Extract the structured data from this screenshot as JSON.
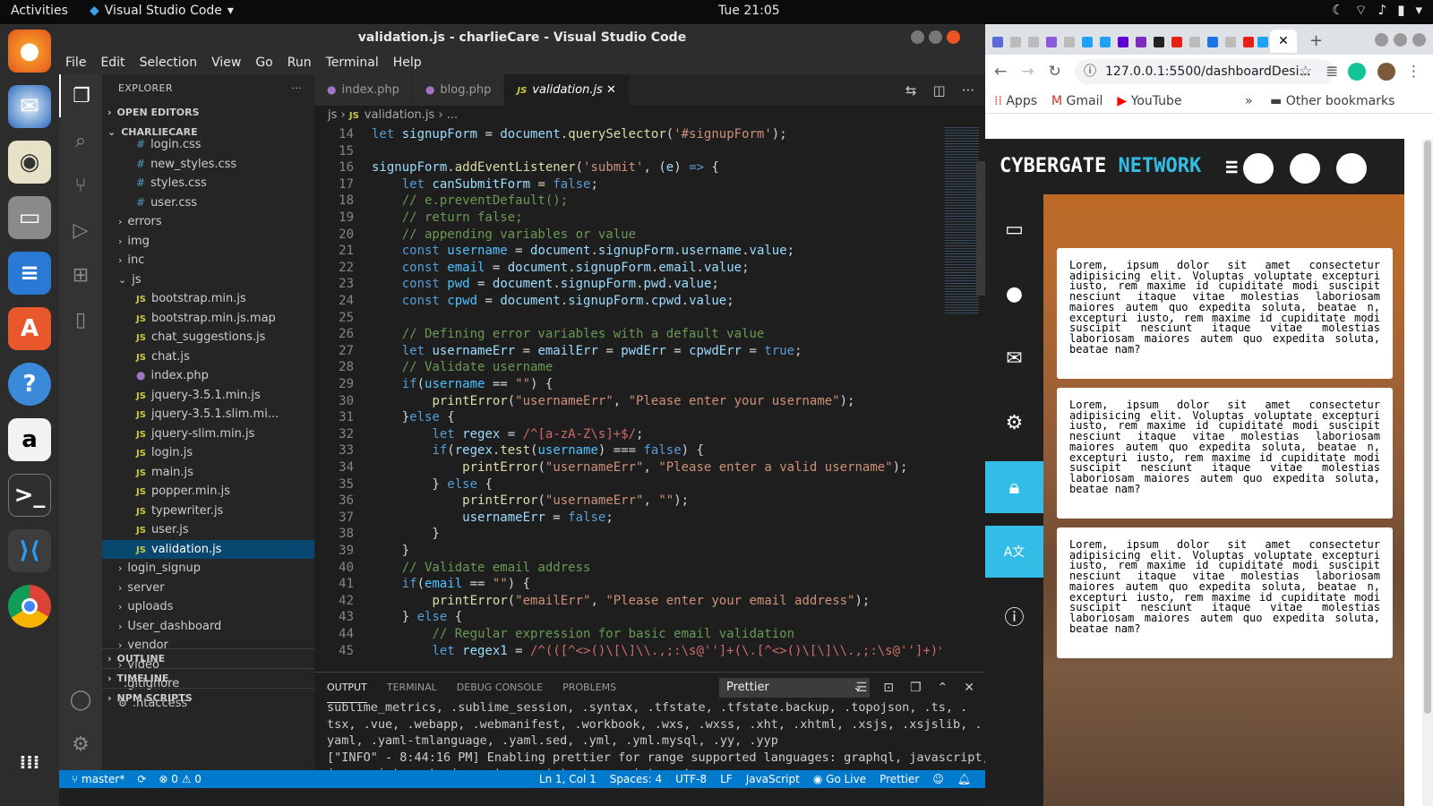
{
  "topbar": {
    "activities": "Activities",
    "app": "Visual Studio Code",
    "clock": "Tue 21:05"
  },
  "vscode": {
    "title": "validation.js - charlieCare - Visual Studio Code",
    "menu": [
      "File",
      "Edit",
      "Selection",
      "View",
      "Go",
      "Run",
      "Terminal",
      "Help"
    ],
    "explorer": {
      "header": "EXPLORER",
      "open_editors": "OPEN EDITORS",
      "project": "CHARLIECARE",
      "files": [
        {
          "name": "login.css",
          "type": "css",
          "indent": 1
        },
        {
          "name": "new_styles.css",
          "type": "css",
          "indent": 1
        },
        {
          "name": "styles.css",
          "type": "css",
          "indent": 1
        },
        {
          "name": "user.css",
          "type": "css",
          "indent": 1
        },
        {
          "name": "errors",
          "type": "folder",
          "indent": 0
        },
        {
          "name": "img",
          "type": "folder",
          "indent": 0
        },
        {
          "name": "inc",
          "type": "folder",
          "indent": 0
        },
        {
          "name": "js",
          "type": "open",
          "indent": 0
        },
        {
          "name": "bootstrap.min.js",
          "type": "js",
          "indent": 1
        },
        {
          "name": "bootstrap.min.js.map",
          "type": "js",
          "indent": 1
        },
        {
          "name": "chat_suggestions.js",
          "type": "js",
          "indent": 1
        },
        {
          "name": "chat.js",
          "type": "js",
          "indent": 1
        },
        {
          "name": "index.php",
          "type": "php",
          "indent": 1
        },
        {
          "name": "jquery-3.5.1.min.js",
          "type": "js",
          "indent": 1
        },
        {
          "name": "jquery-3.5.1.slim.mi...",
          "type": "js",
          "indent": 1
        },
        {
          "name": "jquery-slim.min.js",
          "type": "js",
          "indent": 1
        },
        {
          "name": "login.js",
          "type": "js",
          "indent": 1
        },
        {
          "name": "main.js",
          "type": "js",
          "indent": 1
        },
        {
          "name": "popper.min.js",
          "type": "js",
          "indent": 1
        },
        {
          "name": "typewriter.js",
          "type": "js",
          "indent": 1
        },
        {
          "name": "user.js",
          "type": "js",
          "indent": 1
        },
        {
          "name": "validation.js",
          "type": "js",
          "indent": 1,
          "selected": true
        },
        {
          "name": "login_signup",
          "type": "folder",
          "indent": 0
        },
        {
          "name": "server",
          "type": "folder",
          "indent": 0
        },
        {
          "name": "uploads",
          "type": "folder",
          "indent": 0
        },
        {
          "name": "User_dashboard",
          "type": "folder",
          "indent": 0
        },
        {
          "name": "vendor",
          "type": "folder",
          "indent": 0
        },
        {
          "name": "video",
          "type": "folder",
          "indent": 0
        },
        {
          "name": ".gitignore",
          "type": "plain",
          "indent": 0
        },
        {
          "name": ".htaccess",
          "type": "gear",
          "indent": 0
        }
      ],
      "outline": "OUTLINE",
      "timeline": "TIMELINE",
      "npm": "NPM SCRIPTS"
    },
    "tabs": [
      {
        "label": "index.php",
        "type": "php"
      },
      {
        "label": "blog.php",
        "type": "php"
      },
      {
        "label": "validation.js",
        "type": "js",
        "active": true
      }
    ],
    "breadcrumb": {
      "folder": "js",
      "file": "validation.js",
      "rest": "..."
    },
    "code": [
      {
        "n": "14",
        "t": [
          [
            "k",
            "let "
          ],
          [
            "v",
            "signupForm"
          ],
          [
            "p",
            " = "
          ],
          [
            "v",
            "document"
          ],
          [
            "p",
            "."
          ],
          [
            "f",
            "querySelector"
          ],
          [
            "p",
            "("
          ],
          [
            "s",
            "'#signupForm'"
          ],
          [
            "p",
            ");"
          ]
        ]
      },
      {
        "n": "15",
        "t": []
      },
      {
        "n": "16",
        "t": [
          [
            "v",
            "signupForm"
          ],
          [
            "p",
            "."
          ],
          [
            "f",
            "addEventListener"
          ],
          [
            "p",
            "("
          ],
          [
            "s",
            "'submit'"
          ],
          [
            "p",
            ", ("
          ],
          [
            "v",
            "e"
          ],
          [
            "p",
            ") "
          ],
          [
            "k",
            "=>"
          ],
          [
            "p",
            " {"
          ]
        ]
      },
      {
        "n": "17",
        "t": [
          [
            "p",
            "    "
          ],
          [
            "k",
            "let "
          ],
          [
            "v",
            "canSubmitForm"
          ],
          [
            "p",
            " = "
          ],
          [
            "k",
            "false"
          ],
          [
            "p",
            ";"
          ]
        ]
      },
      {
        "n": "18",
        "t": [
          [
            "p",
            "    "
          ],
          [
            "c",
            "// e.preventDefault();"
          ]
        ]
      },
      {
        "n": "19",
        "t": [
          [
            "p",
            "    "
          ],
          [
            "c",
            "// return false;"
          ]
        ]
      },
      {
        "n": "20",
        "t": [
          [
            "p",
            "    "
          ],
          [
            "c",
            "// appending variables or value"
          ]
        ]
      },
      {
        "n": "21",
        "t": [
          [
            "p",
            "    "
          ],
          [
            "k",
            "const "
          ],
          [
            "cn",
            "username"
          ],
          [
            "p",
            " = "
          ],
          [
            "v",
            "document"
          ],
          [
            "p",
            "."
          ],
          [
            "v",
            "signupForm"
          ],
          [
            "p",
            "."
          ],
          [
            "v",
            "username"
          ],
          [
            "p",
            "."
          ],
          [
            "v",
            "value"
          ],
          [
            "p",
            ";"
          ]
        ]
      },
      {
        "n": "22",
        "t": [
          [
            "p",
            "    "
          ],
          [
            "k",
            "const "
          ],
          [
            "cn",
            "email"
          ],
          [
            "p",
            " = "
          ],
          [
            "v",
            "document"
          ],
          [
            "p",
            "."
          ],
          [
            "v",
            "signupForm"
          ],
          [
            "p",
            "."
          ],
          [
            "v",
            "email"
          ],
          [
            "p",
            "."
          ],
          [
            "v",
            "value"
          ],
          [
            "p",
            ";"
          ]
        ]
      },
      {
        "n": "23",
        "t": [
          [
            "p",
            "    "
          ],
          [
            "k",
            "const "
          ],
          [
            "cn",
            "pwd"
          ],
          [
            "p",
            " = "
          ],
          [
            "v",
            "document"
          ],
          [
            "p",
            "."
          ],
          [
            "v",
            "signupForm"
          ],
          [
            "p",
            "."
          ],
          [
            "v",
            "pwd"
          ],
          [
            "p",
            "."
          ],
          [
            "v",
            "value"
          ],
          [
            "p",
            ";"
          ]
        ]
      },
      {
        "n": "24",
        "t": [
          [
            "p",
            "    "
          ],
          [
            "k",
            "const "
          ],
          [
            "cn",
            "cpwd"
          ],
          [
            "p",
            " = "
          ],
          [
            "v",
            "document"
          ],
          [
            "p",
            "."
          ],
          [
            "v",
            "signupForm"
          ],
          [
            "p",
            "."
          ],
          [
            "v",
            "cpwd"
          ],
          [
            "p",
            "."
          ],
          [
            "v",
            "value"
          ],
          [
            "p",
            ";"
          ]
        ]
      },
      {
        "n": "25",
        "t": []
      },
      {
        "n": "26",
        "t": [
          [
            "p",
            "    "
          ],
          [
            "c",
            "// Defining error variables with a default value"
          ]
        ]
      },
      {
        "n": "27",
        "t": [
          [
            "p",
            "    "
          ],
          [
            "k",
            "let "
          ],
          [
            "v",
            "usernameErr"
          ],
          [
            "p",
            " = "
          ],
          [
            "v",
            "emailErr"
          ],
          [
            "p",
            " = "
          ],
          [
            "v",
            "pwdErr"
          ],
          [
            "p",
            " = "
          ],
          [
            "v",
            "cpwdErr"
          ],
          [
            "p",
            " = "
          ],
          [
            "k",
            "true"
          ],
          [
            "p",
            ";"
          ]
        ]
      },
      {
        "n": "28",
        "t": [
          [
            "p",
            "    "
          ],
          [
            "c",
            "// Validate username"
          ]
        ]
      },
      {
        "n": "29",
        "t": [
          [
            "p",
            "    "
          ],
          [
            "k",
            "if"
          ],
          [
            "p",
            "("
          ],
          [
            "cn",
            "username"
          ],
          [
            "p",
            " == "
          ],
          [
            "s",
            "\"\""
          ],
          [
            "p",
            ") {"
          ]
        ]
      },
      {
        "n": "30",
        "t": [
          [
            "p",
            "        "
          ],
          [
            "f",
            "printError"
          ],
          [
            "p",
            "("
          ],
          [
            "s",
            "\"usernameErr\""
          ],
          [
            "p",
            ", "
          ],
          [
            "s",
            "\"Please enter your username\""
          ],
          [
            "p",
            ");"
          ]
        ]
      },
      {
        "n": "31",
        "t": [
          [
            "p",
            "    }"
          ],
          [
            "k",
            "else"
          ],
          [
            "p",
            " {"
          ]
        ]
      },
      {
        "n": "32",
        "t": [
          [
            "p",
            "        "
          ],
          [
            "k",
            "let "
          ],
          [
            "v",
            "regex"
          ],
          [
            "p",
            " = "
          ],
          [
            "r",
            "/^[a-zA-Z\\s]+$/"
          ],
          [
            "p",
            ";"
          ]
        ]
      },
      {
        "n": "33",
        "t": [
          [
            "p",
            "        "
          ],
          [
            "k",
            "if"
          ],
          [
            "p",
            "("
          ],
          [
            "v",
            "regex"
          ],
          [
            "p",
            "."
          ],
          [
            "f",
            "test"
          ],
          [
            "p",
            "("
          ],
          [
            "cn",
            "username"
          ],
          [
            "p",
            ") === "
          ],
          [
            "k",
            "false"
          ],
          [
            "p",
            ") {"
          ]
        ]
      },
      {
        "n": "34",
        "t": [
          [
            "p",
            "            "
          ],
          [
            "f",
            "printError"
          ],
          [
            "p",
            "("
          ],
          [
            "s",
            "\"usernameErr\""
          ],
          [
            "p",
            ", "
          ],
          [
            "s",
            "\"Please enter a valid username\""
          ],
          [
            "p",
            ");"
          ]
        ]
      },
      {
        "n": "35",
        "t": [
          [
            "p",
            "        } "
          ],
          [
            "k",
            "else"
          ],
          [
            "p",
            " {"
          ]
        ]
      },
      {
        "n": "36",
        "t": [
          [
            "p",
            "            "
          ],
          [
            "f",
            "printError"
          ],
          [
            "p",
            "("
          ],
          [
            "s",
            "\"usernameErr\""
          ],
          [
            "p",
            ", "
          ],
          [
            "s",
            "\"\""
          ],
          [
            "p",
            ");"
          ]
        ]
      },
      {
        "n": "37",
        "t": [
          [
            "p",
            "            "
          ],
          [
            "v",
            "usernameErr"
          ],
          [
            "p",
            " = "
          ],
          [
            "k",
            "false"
          ],
          [
            "p",
            ";"
          ]
        ]
      },
      {
        "n": "38",
        "t": [
          [
            "p",
            "        }"
          ]
        ]
      },
      {
        "n": "39",
        "t": [
          [
            "p",
            "    }"
          ]
        ]
      },
      {
        "n": "40",
        "t": [
          [
            "p",
            "    "
          ],
          [
            "c",
            "// Validate email address"
          ]
        ]
      },
      {
        "n": "41",
        "t": [
          [
            "p",
            "    "
          ],
          [
            "k",
            "if"
          ],
          [
            "p",
            "("
          ],
          [
            "cn",
            "email"
          ],
          [
            "p",
            " == "
          ],
          [
            "s",
            "\"\""
          ],
          [
            "p",
            ") {"
          ]
        ]
      },
      {
        "n": "42",
        "t": [
          [
            "p",
            "        "
          ],
          [
            "f",
            "printError"
          ],
          [
            "p",
            "("
          ],
          [
            "s",
            "\"emailErr\""
          ],
          [
            "p",
            ", "
          ],
          [
            "s",
            "\"Please enter your email address\""
          ],
          [
            "p",
            ");"
          ]
        ]
      },
      {
        "n": "43",
        "t": [
          [
            "p",
            "    } "
          ],
          [
            "k",
            "else"
          ],
          [
            "p",
            " {"
          ]
        ]
      },
      {
        "n": "44",
        "t": [
          [
            "p",
            "        "
          ],
          [
            "c",
            "// Regular expression for basic email validation"
          ]
        ]
      },
      {
        "n": "45",
        "t": [
          [
            "p",
            "        "
          ],
          [
            "k",
            "let "
          ],
          [
            "v",
            "regex1"
          ],
          [
            "p",
            " = "
          ],
          [
            "r",
            "/^(([^<>()\\[\\]\\\\.,;:\\s@'']+(\\.[^<>()\\[\\]\\\\.,;:\\s@'']+)*)|(."
          ]
        ]
      }
    ],
    "panel": {
      "tabs": [
        "OUTPUT",
        "TERMINAL",
        "DEBUG CONSOLE",
        "PROBLEMS"
      ],
      "channel": "Prettier",
      "lines": [
        "sublime_metrics, .sublime_session, .syntax, .tfstate, .tfstate.backup, .topojson, .ts, .",
        "tsx, .vue, .webapp, .webmanifest, .workbook, .wxs, .wxss, .xht, .xhtml, .xsjs, .xsjslib, .",
        "yaml, .yaml-tmlanguage, .yaml.sed, .yml, .yml.mysql, .yy, .yyp",
        "[\"INFO\" - 8:44:16 PM] Enabling prettier for range supported languages: graphql, javascript,",
        "javascriptreact, json, typescript, typescriptreact"
      ]
    },
    "status": {
      "branch": "master*",
      "sync": "⟳",
      "errors": "⊗ 0 ⚠ 0",
      "position": "Ln 1, Col 1",
      "spaces": "Spaces: 4",
      "encoding": "UTF-8",
      "eol": "LF",
      "language": "JavaScript",
      "golive": "Go Live",
      "prettier": "Prettier"
    }
  },
  "chrome": {
    "url": "127.0.0.1:5500/dashboardDesi...",
    "bookmarks": [
      "Apps",
      "Gmail",
      "YouTube"
    ],
    "other": "Other bookmarks",
    "page": {
      "brand1": "CYBERGATE",
      "brand2": "NETWORK",
      "card_text": "Lorem, ipsum dolor sit amet consectetur adipisicing elit. Voluptas voluptate excepturi iusto, rem maxime id cupiditate modi suscipit nesciunt itaque vitae molestias laboriosam maiores autem quo expedita soluta, beatae n, excepturi iusto, rem maxime id cupiditate modi suscipit nesciunt itaque vitae molestias laboriosam maiores autem quo expedita soluta, beatae nam?",
      "side_icons": [
        "monitor-icon",
        "user-icon",
        "mail-icon",
        "gear-icon",
        "lock-icon",
        "translate-icon",
        "info-icon"
      ]
    }
  }
}
